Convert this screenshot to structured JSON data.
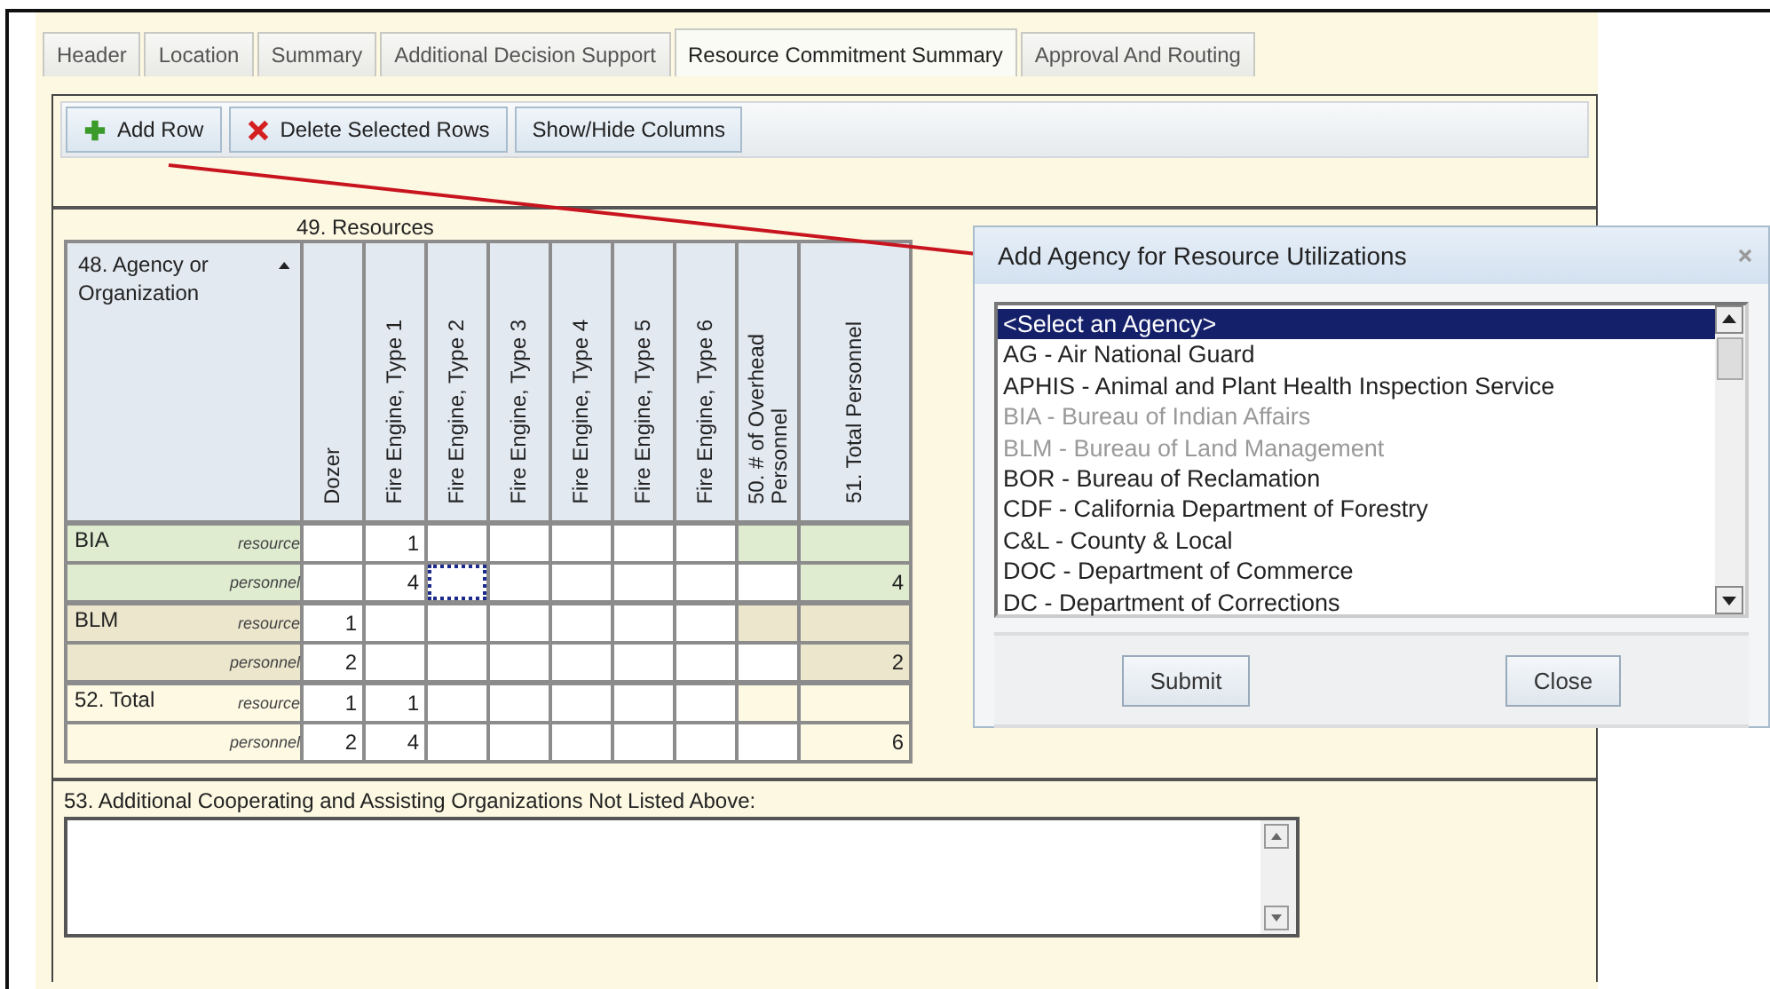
{
  "tabs": [
    {
      "label": "Header",
      "selected": false
    },
    {
      "label": "Location",
      "selected": false
    },
    {
      "label": "Summary",
      "selected": false
    },
    {
      "label": "Additional Decision Support",
      "selected": false
    },
    {
      "label": "Resource Commitment Summary",
      "selected": true
    },
    {
      "label": "Approval And Routing",
      "selected": false
    }
  ],
  "toolbar": [
    {
      "label": "Add Row",
      "kind": "add"
    },
    {
      "label": "Delete Selected Rows",
      "kind": "delete"
    },
    {
      "label": "Show/Hide Columns",
      "kind": "columns"
    }
  ],
  "resources_table": {
    "group_label": "49. Resources",
    "agency_header": "48. Agency or Organization",
    "columns": [
      {
        "label": "Dozer",
        "kind": "input"
      },
      {
        "label": "Fire Engine, Type 1",
        "kind": "input"
      },
      {
        "label": "Fire Engine, Type 2",
        "kind": "input"
      },
      {
        "label": "Fire Engine, Type 3",
        "kind": "input"
      },
      {
        "label": "Fire Engine, Type 4",
        "kind": "input"
      },
      {
        "label": "Fire Engine, Type 5",
        "kind": "input"
      },
      {
        "label": "Fire Engine, Type 6",
        "kind": "input"
      },
      {
        "label": "50. # of Overhead Personnel",
        "kind": "overhead"
      },
      {
        "label": "51. Total Personnel",
        "kind": "total"
      }
    ],
    "groups": [
      {
        "agency": "BIA",
        "color": "#dfecd0",
        "rows": [
          {
            "label": "resource",
            "kind": "resource",
            "cells": [
              {
                "focused": false
              },
              {
                "v": "1",
                "focused": false
              },
              {
                "focused": false
              },
              {
                "focused": false
              },
              {
                "focused": false
              },
              {
                "focused": false
              },
              {
                "focused": false
              },
              {
                "focused": false
              },
              {
                "focused": false
              }
            ]
          },
          {
            "label": "personnel",
            "kind": "personnel",
            "cells": [
              {
                "focused": false
              },
              {
                "v": "4",
                "focused": false
              },
              {
                "focused": true
              },
              {
                "focused": false
              },
              {
                "focused": false
              },
              {
                "focused": false
              },
              {
                "focused": false
              },
              {
                "focused": false
              },
              {
                "v": "4",
                "focused": false
              }
            ]
          }
        ]
      },
      {
        "agency": "BLM",
        "color": "#ece6cc",
        "rows": [
          {
            "label": "resource",
            "kind": "resource",
            "cells": [
              {
                "v": "1",
                "focused": false
              },
              {
                "focused": false
              },
              {
                "focused": false
              },
              {
                "focused": false
              },
              {
                "focused": false
              },
              {
                "focused": false
              },
              {
                "focused": false
              },
              {
                "focused": false
              },
              {
                "focused": false
              }
            ]
          },
          {
            "label": "personnel",
            "kind": "personnel",
            "cells": [
              {
                "v": "2",
                "focused": false
              },
              {
                "focused": false
              },
              {
                "focused": false
              },
              {
                "focused": false
              },
              {
                "focused": false
              },
              {
                "focused": false
              },
              {
                "focused": false
              },
              {
                "focused": false
              },
              {
                "v": "2",
                "focused": false
              }
            ]
          }
        ]
      },
      {
        "agency": "52. Total",
        "color": "#fdf9e3",
        "rows": [
          {
            "label": "resource",
            "kind": "resource",
            "cells": [
              {
                "v": "1",
                "focused": false
              },
              {
                "v": "1",
                "focused": false
              },
              {
                "focused": false
              },
              {
                "focused": false
              },
              {
                "focused": false
              },
              {
                "focused": false
              },
              {
                "focused": false
              },
              {
                "focused": false
              },
              {
                "focused": false
              }
            ]
          },
          {
            "label": "personnel",
            "kind": "personnel",
            "cells": [
              {
                "v": "2",
                "focused": false
              },
              {
                "v": "4",
                "focused": false
              },
              {
                "focused": false
              },
              {
                "focused": false
              },
              {
                "focused": false
              },
              {
                "focused": false
              },
              {
                "focused": false
              },
              {
                "focused": false
              },
              {
                "v": "6",
                "focused": false
              }
            ]
          }
        ]
      }
    ]
  },
  "additional_orgs": {
    "label": "53. Additional Cooperating and Assisting Organizations Not Listed Above:"
  },
  "dialog": {
    "title": "Add Agency for Resource Utilizations",
    "options": [
      {
        "label": "<Select an Agency>",
        "selected": true,
        "disabled": false
      },
      {
        "label": "AG - Air National Guard",
        "selected": false,
        "disabled": false
      },
      {
        "label": "APHIS - Animal and Plant Health Inspection Service",
        "selected": false,
        "disabled": false
      },
      {
        "label": "BIA - Bureau of Indian Affairs",
        "selected": false,
        "disabled": true
      },
      {
        "label": "BLM - Bureau of Land Management",
        "selected": false,
        "disabled": true
      },
      {
        "label": "BOR - Bureau of Reclamation",
        "selected": false,
        "disabled": false
      },
      {
        "label": "CDF - California Department of Forestry",
        "selected": false,
        "disabled": false
      },
      {
        "label": "C&L - County & Local",
        "selected": false,
        "disabled": false
      },
      {
        "label": "DOC - Department of Commerce",
        "selected": false,
        "disabled": false
      },
      {
        "label": "DC - Department of Corrections",
        "selected": false,
        "disabled": false
      }
    ],
    "buttons": [
      "Submit",
      "Close"
    ]
  }
}
